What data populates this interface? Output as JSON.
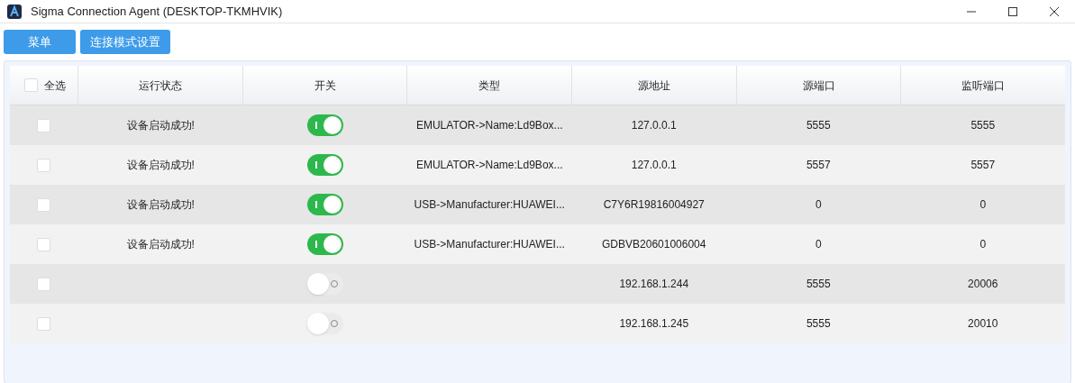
{
  "window": {
    "title": "Sigma Connection Agent (DESKTOP-TKMHVIK)"
  },
  "toolbar": [
    "菜单",
    "连接模式设置"
  ],
  "table": {
    "select_all": {
      "label": "全选",
      "checked": false
    },
    "columns": [
      "运行状态",
      "开关",
      "类型",
      "源地址",
      "源端口",
      "监听端口"
    ],
    "rows": [
      {
        "checked": false,
        "status": "设备启动成功!",
        "on": true,
        "type": "EMULATOR->Name:Ld9Box...",
        "address": "127.0.0.1",
        "source_port": "5555",
        "listen_port": "5555"
      },
      {
        "checked": false,
        "status": "设备启动成功!",
        "on": true,
        "type": "EMULATOR->Name:Ld9Box...",
        "address": "127.0.0.1",
        "source_port": "5557",
        "listen_port": "5557"
      },
      {
        "checked": false,
        "status": "设备启动成功!",
        "on": true,
        "type": "USB->Manufacturer:HUAWEI...",
        "address": "C7Y6R19816004927",
        "source_port": "0",
        "listen_port": "0"
      },
      {
        "checked": false,
        "status": "设备启动成功!",
        "on": true,
        "type": "USB->Manufacturer:HUAWEI...",
        "address": "GDBVB20601006004",
        "source_port": "0",
        "listen_port": "0"
      },
      {
        "checked": false,
        "on": false,
        "address": "192.168.1.244",
        "source_port": "5555",
        "listen_port": "20006"
      },
      {
        "checked": false,
        "on": false,
        "address": "192.168.1.245",
        "source_port": "5555",
        "listen_port": "20010"
      }
    ]
  }
}
